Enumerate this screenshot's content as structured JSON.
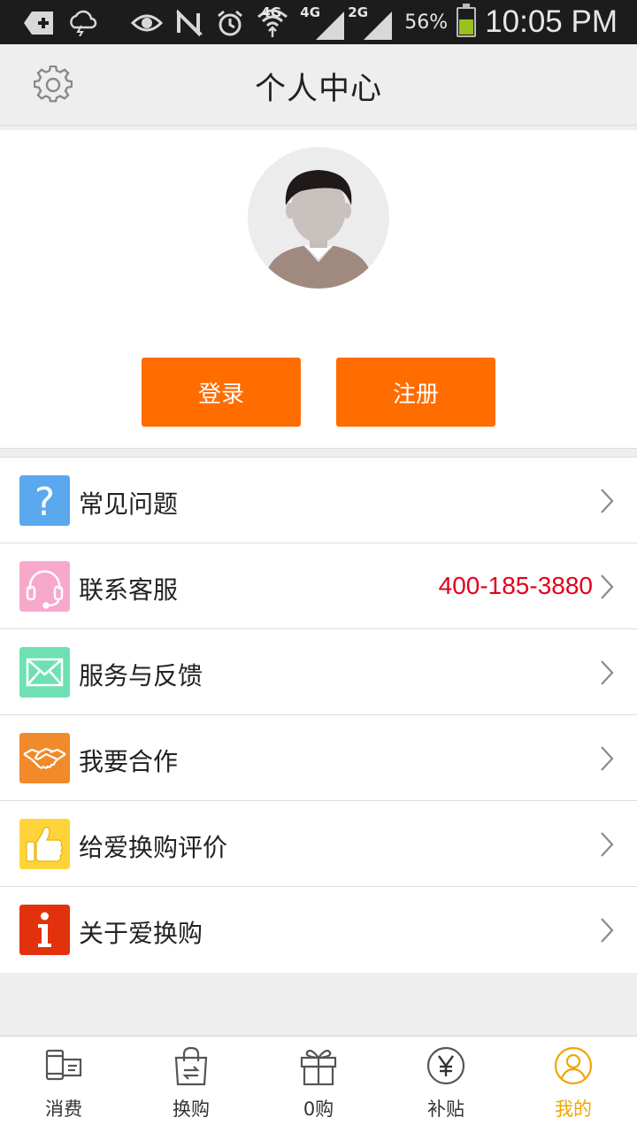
{
  "status_bar": {
    "network_1": "4G",
    "network_2": "4G",
    "network_3": "2G",
    "battery_percent": "56%",
    "battery_level": 0.56,
    "time": "10:05 PM"
  },
  "header": {
    "title": "个人中心",
    "settings_icon": "gear-icon"
  },
  "profile": {
    "avatar_icon": "default-avatar",
    "login_label": "登录",
    "register_label": "注册"
  },
  "menu": {
    "items": [
      {
        "label": "常见问题",
        "icon": "question-icon",
        "icon_color": "#5aa8ee",
        "value": ""
      },
      {
        "label": "联系客服",
        "icon": "headset-icon",
        "icon_color": "#f7a9cc",
        "value": "400-185-3880"
      },
      {
        "label": "服务与反馈",
        "icon": "mail-icon",
        "icon_color": "#6fe0b4",
        "value": ""
      },
      {
        "label": "我要合作",
        "icon": "handshake-icon",
        "icon_color": "#f08a2a",
        "value": ""
      },
      {
        "label": "给爱换购评价",
        "icon": "thumbs-up-icon",
        "icon_color": "#ffd43a",
        "value": ""
      },
      {
        "label": "关于爱换购",
        "icon": "info-icon",
        "icon_color": "#e2320d",
        "value": ""
      }
    ]
  },
  "bottom_nav": {
    "active_color": "#f0a500",
    "items": [
      {
        "label": "消费",
        "icon": "phone-card-icon"
      },
      {
        "label": "换购",
        "icon": "shopping-bag-icon"
      },
      {
        "label": "0购",
        "icon": "gift-icon"
      },
      {
        "label": "补贴",
        "icon": "yen-coin-icon"
      },
      {
        "label": "我的",
        "icon": "user-icon"
      }
    ]
  }
}
